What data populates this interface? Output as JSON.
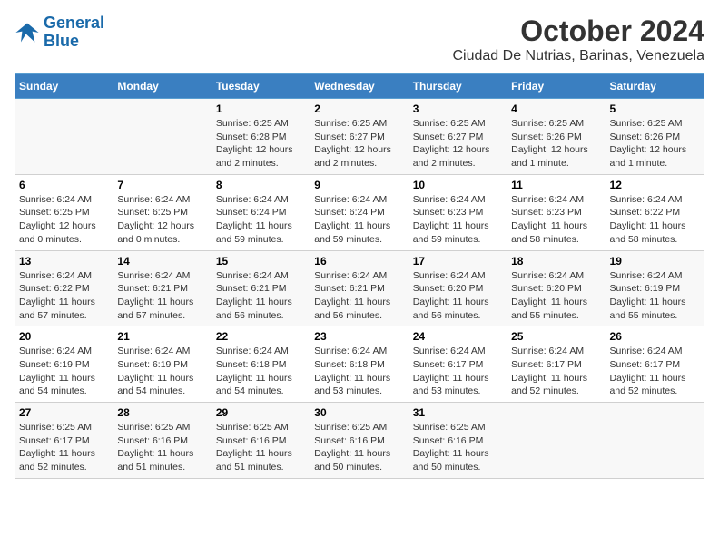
{
  "logo": {
    "line1": "General",
    "line2": "Blue"
  },
  "header": {
    "month": "October 2024",
    "location": "Ciudad De Nutrias, Barinas, Venezuela"
  },
  "days_of_week": [
    "Sunday",
    "Monday",
    "Tuesday",
    "Wednesday",
    "Thursday",
    "Friday",
    "Saturday"
  ],
  "weeks": [
    [
      {
        "day": "",
        "details": ""
      },
      {
        "day": "",
        "details": ""
      },
      {
        "day": "1",
        "details": "Sunrise: 6:25 AM\nSunset: 6:28 PM\nDaylight: 12 hours and 2 minutes."
      },
      {
        "day": "2",
        "details": "Sunrise: 6:25 AM\nSunset: 6:27 PM\nDaylight: 12 hours and 2 minutes."
      },
      {
        "day": "3",
        "details": "Sunrise: 6:25 AM\nSunset: 6:27 PM\nDaylight: 12 hours and 2 minutes."
      },
      {
        "day": "4",
        "details": "Sunrise: 6:25 AM\nSunset: 6:26 PM\nDaylight: 12 hours and 1 minute."
      },
      {
        "day": "5",
        "details": "Sunrise: 6:25 AM\nSunset: 6:26 PM\nDaylight: 12 hours and 1 minute."
      }
    ],
    [
      {
        "day": "6",
        "details": "Sunrise: 6:24 AM\nSunset: 6:25 PM\nDaylight: 12 hours and 0 minutes."
      },
      {
        "day": "7",
        "details": "Sunrise: 6:24 AM\nSunset: 6:25 PM\nDaylight: 12 hours and 0 minutes."
      },
      {
        "day": "8",
        "details": "Sunrise: 6:24 AM\nSunset: 6:24 PM\nDaylight: 11 hours and 59 minutes."
      },
      {
        "day": "9",
        "details": "Sunrise: 6:24 AM\nSunset: 6:24 PM\nDaylight: 11 hours and 59 minutes."
      },
      {
        "day": "10",
        "details": "Sunrise: 6:24 AM\nSunset: 6:23 PM\nDaylight: 11 hours and 59 minutes."
      },
      {
        "day": "11",
        "details": "Sunrise: 6:24 AM\nSunset: 6:23 PM\nDaylight: 11 hours and 58 minutes."
      },
      {
        "day": "12",
        "details": "Sunrise: 6:24 AM\nSunset: 6:22 PM\nDaylight: 11 hours and 58 minutes."
      }
    ],
    [
      {
        "day": "13",
        "details": "Sunrise: 6:24 AM\nSunset: 6:22 PM\nDaylight: 11 hours and 57 minutes."
      },
      {
        "day": "14",
        "details": "Sunrise: 6:24 AM\nSunset: 6:21 PM\nDaylight: 11 hours and 57 minutes."
      },
      {
        "day": "15",
        "details": "Sunrise: 6:24 AM\nSunset: 6:21 PM\nDaylight: 11 hours and 56 minutes."
      },
      {
        "day": "16",
        "details": "Sunrise: 6:24 AM\nSunset: 6:21 PM\nDaylight: 11 hours and 56 minutes."
      },
      {
        "day": "17",
        "details": "Sunrise: 6:24 AM\nSunset: 6:20 PM\nDaylight: 11 hours and 56 minutes."
      },
      {
        "day": "18",
        "details": "Sunrise: 6:24 AM\nSunset: 6:20 PM\nDaylight: 11 hours and 55 minutes."
      },
      {
        "day": "19",
        "details": "Sunrise: 6:24 AM\nSunset: 6:19 PM\nDaylight: 11 hours and 55 minutes."
      }
    ],
    [
      {
        "day": "20",
        "details": "Sunrise: 6:24 AM\nSunset: 6:19 PM\nDaylight: 11 hours and 54 minutes."
      },
      {
        "day": "21",
        "details": "Sunrise: 6:24 AM\nSunset: 6:19 PM\nDaylight: 11 hours and 54 minutes."
      },
      {
        "day": "22",
        "details": "Sunrise: 6:24 AM\nSunset: 6:18 PM\nDaylight: 11 hours and 54 minutes."
      },
      {
        "day": "23",
        "details": "Sunrise: 6:24 AM\nSunset: 6:18 PM\nDaylight: 11 hours and 53 minutes."
      },
      {
        "day": "24",
        "details": "Sunrise: 6:24 AM\nSunset: 6:17 PM\nDaylight: 11 hours and 53 minutes."
      },
      {
        "day": "25",
        "details": "Sunrise: 6:24 AM\nSunset: 6:17 PM\nDaylight: 11 hours and 52 minutes."
      },
      {
        "day": "26",
        "details": "Sunrise: 6:24 AM\nSunset: 6:17 PM\nDaylight: 11 hours and 52 minutes."
      }
    ],
    [
      {
        "day": "27",
        "details": "Sunrise: 6:25 AM\nSunset: 6:17 PM\nDaylight: 11 hours and 52 minutes."
      },
      {
        "day": "28",
        "details": "Sunrise: 6:25 AM\nSunset: 6:16 PM\nDaylight: 11 hours and 51 minutes."
      },
      {
        "day": "29",
        "details": "Sunrise: 6:25 AM\nSunset: 6:16 PM\nDaylight: 11 hours and 51 minutes."
      },
      {
        "day": "30",
        "details": "Sunrise: 6:25 AM\nSunset: 6:16 PM\nDaylight: 11 hours and 50 minutes."
      },
      {
        "day": "31",
        "details": "Sunrise: 6:25 AM\nSunset: 6:16 PM\nDaylight: 11 hours and 50 minutes."
      },
      {
        "day": "",
        "details": ""
      },
      {
        "day": "",
        "details": ""
      }
    ]
  ]
}
